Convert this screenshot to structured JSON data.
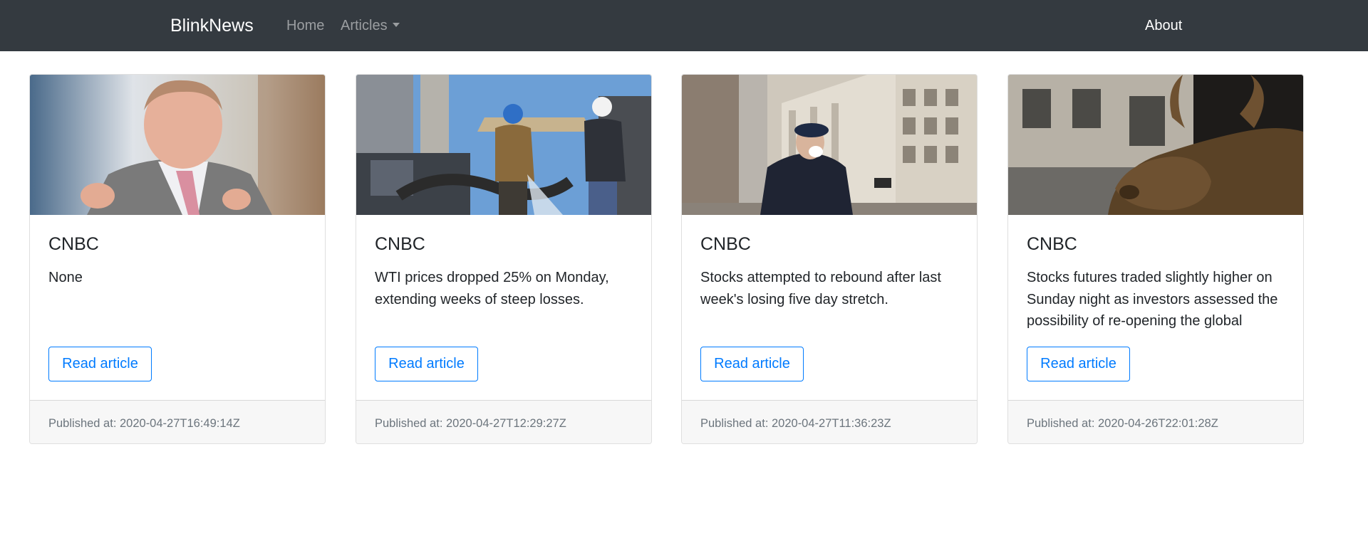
{
  "navbar": {
    "brand": "BlinkNews",
    "links": {
      "home": "Home",
      "articles": "Articles",
      "about": "About"
    }
  },
  "articles": [
    {
      "source": "CNBC",
      "description": "None",
      "button_label": "Read article",
      "footer": "Published at: 2020-04-27T16:49:14Z"
    },
    {
      "source": "CNBC",
      "description": "WTI prices dropped 25% on Monday, extending weeks of steep losses.",
      "button_label": "Read article",
      "footer": "Published at: 2020-04-27T12:29:27Z"
    },
    {
      "source": "CNBC",
      "description": "Stocks attempted to rebound after last week's losing five day stretch.",
      "button_label": "Read article",
      "footer": "Published at: 2020-04-27T11:36:23Z"
    },
    {
      "source": "CNBC",
      "description": "Stocks futures traded slightly higher on Sunday night as investors assessed the possibility of re-opening the global",
      "button_label": "Read article",
      "footer": "Published at: 2020-04-26T22:01:28Z"
    }
  ],
  "colors": {
    "navbar_bg": "#343a40",
    "link_primary": "#007bff",
    "footer_bg": "#f7f7f7",
    "muted_text": "#6c757d"
  }
}
